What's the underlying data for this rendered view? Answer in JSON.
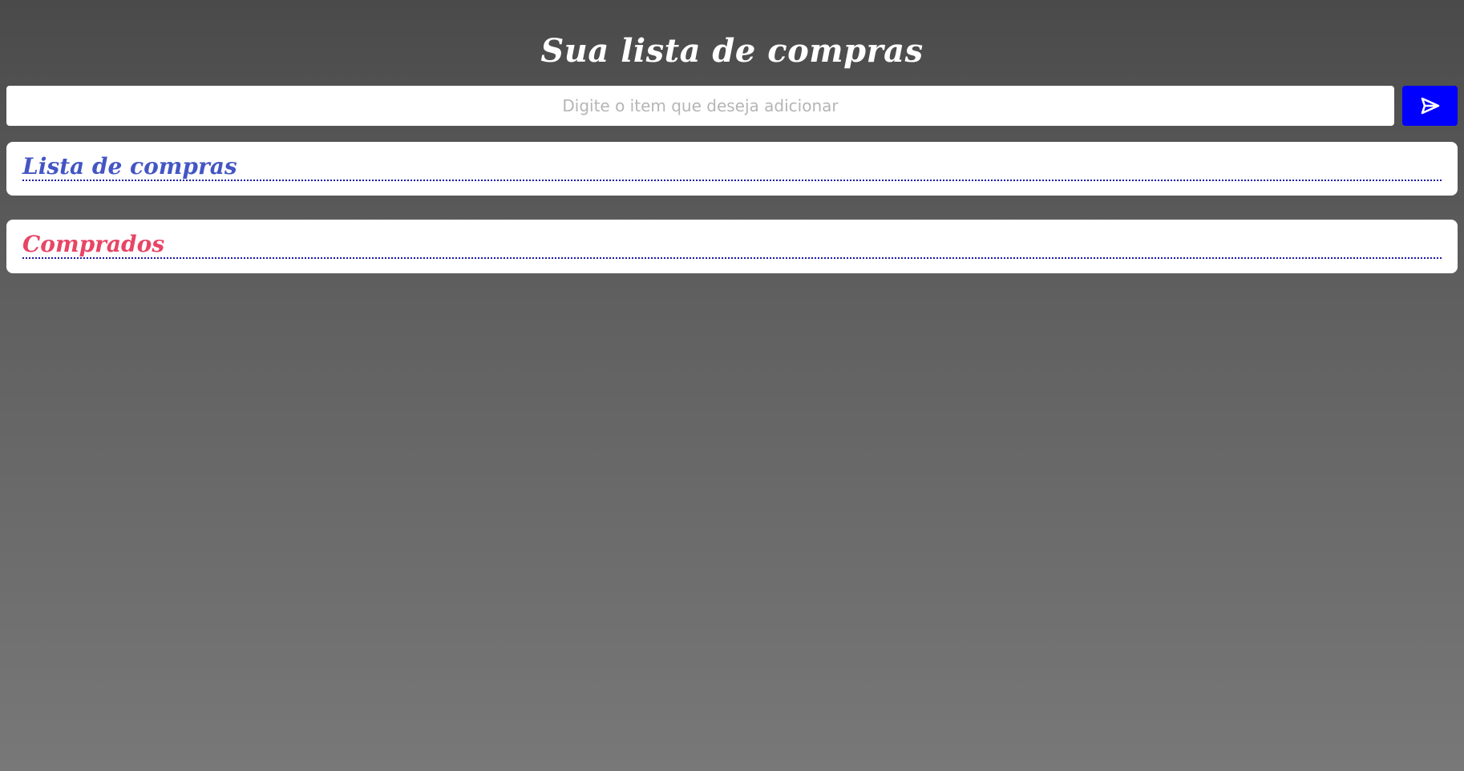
{
  "header": {
    "title": "Sua lista de compras"
  },
  "form": {
    "input_placeholder": "Digite o item que deseja adicionar",
    "input_value": "",
    "submit_icon": "send-icon"
  },
  "lists": {
    "shopping": {
      "title": "Lista de compras",
      "items": []
    },
    "bought": {
      "title": "Comprados",
      "items": []
    }
  },
  "colors": {
    "submit_button": "#0000ff",
    "shopping_title": "#4456c4",
    "bought_title": "#e84565",
    "divider": "#1a1aa8",
    "background_top": "#4a4a4a",
    "background_bottom": "#787878"
  }
}
